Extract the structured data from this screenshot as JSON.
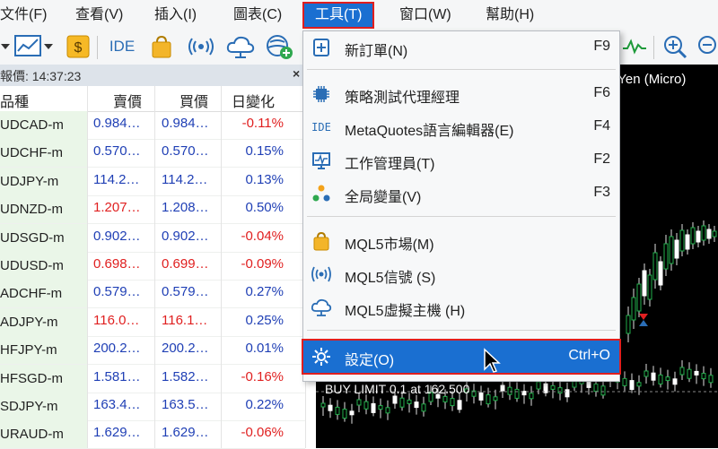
{
  "menubar": {
    "items": [
      {
        "label": "文件(F)"
      },
      {
        "label": "查看(V)"
      },
      {
        "label": "插入(I)"
      },
      {
        "label": "圖表(C)"
      },
      {
        "label": "工具(T)"
      },
      {
        "label": "窗口(W)"
      },
      {
        "label": "幫助(H)"
      }
    ]
  },
  "toolbar": {
    "ide_label": "IDE",
    "icons": [
      "new-chart-icon",
      "dollar-icon",
      "ide-icon",
      "market-bag-icon",
      "signal-icon",
      "cloud-icon",
      "globe-plus-icon",
      "indicator-icon",
      "zoom-in-icon",
      "zoom-out-icon"
    ]
  },
  "market_watch": {
    "title": "報價: 14:37:23",
    "close": "×",
    "columns": [
      "品種",
      "賣價",
      "買價",
      "日變化"
    ],
    "rows": [
      {
        "symbol": "UDCAD-m",
        "bid": "0.984…",
        "ask": "0.984…",
        "change": "-0.11%"
      },
      {
        "symbol": "UDCHF-m",
        "bid": "0.570…",
        "ask": "0.570…",
        "change": "0.15%"
      },
      {
        "symbol": "UDJPY-m",
        "bid": "114.2…",
        "ask": "114.2…",
        "change": "0.13%"
      },
      {
        "symbol": "UDNZD-m",
        "bid": "1.207…",
        "ask": "1.208…",
        "change": "0.50%"
      },
      {
        "symbol": "UDSGD-m",
        "bid": "0.902…",
        "ask": "0.902…",
        "change": "-0.04%"
      },
      {
        "symbol": "UDUSD-m",
        "bid": "0.698…",
        "ask": "0.699…",
        "change": "-0.09%"
      },
      {
        "symbol": "ADCHF-m",
        "bid": "0.579…",
        "ask": "0.579…",
        "change": "0.27%"
      },
      {
        "symbol": "ADJPY-m",
        "bid": "116.0…",
        "ask": "116.1…",
        "change": "0.25%"
      },
      {
        "symbol": "HFJPY-m",
        "bid": "200.2…",
        "ask": "200.2…",
        "change": "0.01%"
      },
      {
        "symbol": "HFSGD-m",
        "bid": "1.581…",
        "ask": "1.582…",
        "change": "-0.16%"
      },
      {
        "symbol": "SDJPY-m",
        "bid": "163.4…",
        "ask": "163.5…",
        "change": "0.22%"
      },
      {
        "symbol": "URAUD-m",
        "bid": "1.629…",
        "ask": "1.629…",
        "change": "-0.06%"
      }
    ]
  },
  "chart": {
    "title": "e Yen (Micro)",
    "order_label": "BUY LIMIT 0.1 at 162.500"
  },
  "dropdown": {
    "items": [
      {
        "label": "新訂單(N)",
        "shortcut": "F9",
        "icon": "new-order-icon"
      },
      {
        "label": "策略測試代理經理",
        "shortcut": "F6",
        "icon": "chip-icon"
      },
      {
        "label": "MetaQuotes語言編輯器(E)",
        "shortcut": "F4",
        "icon": "ide-icon"
      },
      {
        "label": "工作管理員(T)",
        "shortcut": "F2",
        "icon": "monitor-icon"
      },
      {
        "label": "全局變量(V)",
        "shortcut": "F3",
        "icon": "dots-icon"
      },
      {
        "label": "MQL5市場(M)",
        "shortcut": "",
        "icon": "market-bag-icon"
      },
      {
        "label": "MQL5信號 (S)",
        "shortcut": "",
        "icon": "signal-icon"
      },
      {
        "label": "MQL5虛擬主機 (H)",
        "shortcut": "",
        "icon": "cloud-icon"
      },
      {
        "label": "設定(O)",
        "shortcut": "Ctrl+O",
        "icon": "gear-icon"
      }
    ]
  },
  "colors": {
    "accent": "#1a6fd1",
    "highlight_border": "#e01e1e",
    "positive": "#1f3fb5",
    "negative": "#e02020",
    "symbol_bg": "#eaf6e8",
    "candle_up": "#22b14c",
    "candle_down": "#ffffff"
  }
}
